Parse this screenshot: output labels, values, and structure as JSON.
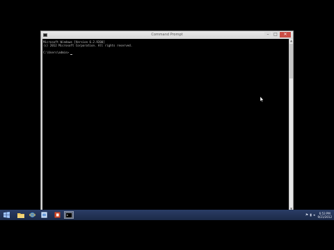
{
  "window": {
    "title": "Command Prompt",
    "minimize_glyph": "–",
    "maximize_glyph": "□",
    "close_glyph": "✕"
  },
  "console": {
    "line1": "Microsoft Windows [Version 6.2.9200]",
    "line2": "(c) 2012 Microsoft Corporation. All rights reserved.",
    "line3": "C:\\Users\\admin>"
  },
  "taskbar": {
    "items": [
      {
        "name": "start",
        "icon": "windows-logo-icon"
      },
      {
        "name": "file-explorer",
        "icon": "folder-icon"
      },
      {
        "name": "internet-explorer",
        "icon": "ie-icon"
      },
      {
        "name": "app",
        "icon": "app-icon"
      },
      {
        "name": "office-app",
        "icon": "office-icon"
      },
      {
        "name": "command-prompt",
        "icon": "cmd-icon",
        "active": true
      }
    ],
    "clock_time": "6:53 PM",
    "clock_date": "9/21/2012"
  },
  "colors": {
    "console_text": "#c0c0c0",
    "taskbar": "#1c2a48",
    "close_button": "#c94d45"
  }
}
